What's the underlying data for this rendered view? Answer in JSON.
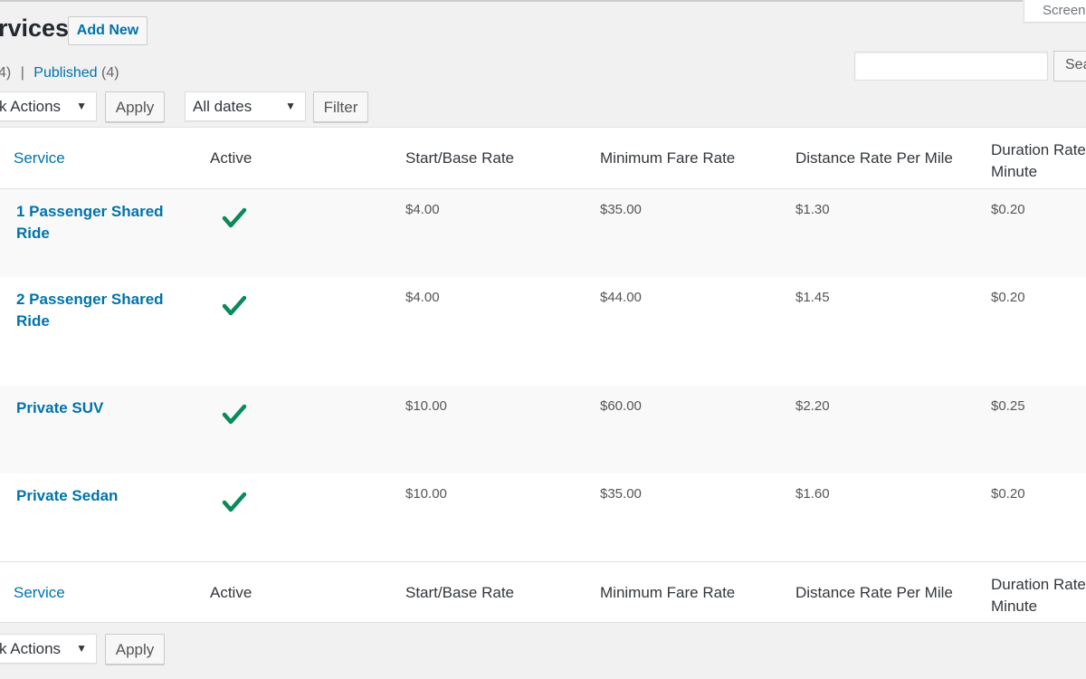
{
  "header": {
    "title": "rvices",
    "add_new": "Add New",
    "screen_options": "Screen"
  },
  "subsubsub": {
    "all_count": "4)",
    "separator": "|",
    "published": "Published",
    "published_count": "(4)"
  },
  "search": {
    "value": "",
    "button": "Sea"
  },
  "toolbar_top": {
    "bulk_actions": "k Actions",
    "apply": "Apply",
    "dates": "All dates",
    "filter": "Filter"
  },
  "toolbar_bottom": {
    "bulk_actions": "k Actions",
    "apply": "Apply"
  },
  "columns": [
    "Service",
    "Active",
    "Start/Base Rate",
    "Minimum Fare Rate",
    "Distance Rate Per Mile",
    "Duration Rate Minute"
  ],
  "colors": {
    "link": "#0073aa",
    "check": "#0a8a5a"
  },
  "rows": [
    {
      "service": "1 Passenger Shared Ride",
      "active": true,
      "start": "$4.00",
      "minimum": "$35.00",
      "distance": "$1.30",
      "duration": "$0.20"
    },
    {
      "service": "2 Passenger Shared Ride",
      "active": true,
      "start": "$4.00",
      "minimum": "$44.00",
      "distance": "$1.45",
      "duration": "$0.20"
    },
    {
      "service": "Private SUV",
      "active": true,
      "start": "$10.00",
      "minimum": "$60.00",
      "distance": "$2.20",
      "duration": "$0.25"
    },
    {
      "service": "Private Sedan",
      "active": true,
      "start": "$10.00",
      "minimum": "$35.00",
      "distance": "$1.60",
      "duration": "$0.20"
    }
  ]
}
